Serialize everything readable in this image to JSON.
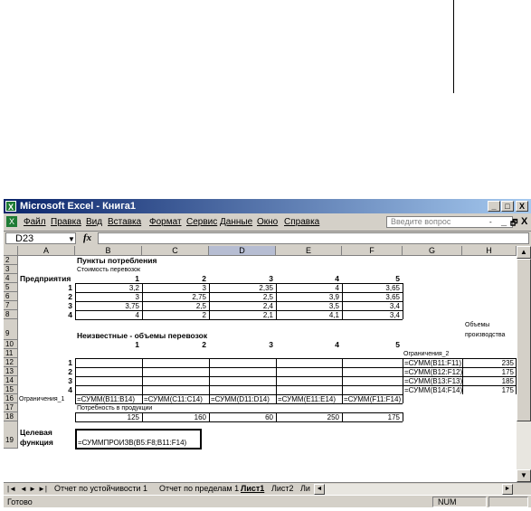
{
  "window": {
    "app_icon": "excel-icon",
    "title": "Microsoft Excel - Книга1",
    "controls": {
      "minimize": "_",
      "maximize": "□",
      "close": "X"
    }
  },
  "menu": {
    "items": [
      "Файл",
      "Правка",
      "Вид",
      "Вставка",
      "Формат",
      "Сервис",
      "Данные",
      "Окно",
      "Справка"
    ],
    "help_placeholder": "Введите вопрос",
    "doc_controls": [
      "-",
      "_",
      "🗗",
      "X"
    ]
  },
  "formula_bar": {
    "name_box": "D23",
    "fx": "fx",
    "content": ""
  },
  "columns": [
    "A",
    "B",
    "C",
    "D",
    "E",
    "F",
    "G",
    "H"
  ],
  "selected_column": "D",
  "rows": [
    "2",
    "3",
    "4",
    "5",
    "6",
    "7",
    "8",
    "9",
    "10",
    "11",
    "12",
    "13",
    "14",
    "15",
    "16",
    "17",
    "18",
    "19"
  ],
  "cells": {
    "B2": "Пункты потребления",
    "B3": "Стоимость перевозок",
    "A4": "Предприятия",
    "B4": "1",
    "C4": "2",
    "D4": "3",
    "E4": "4",
    "F4": "5",
    "A5": "1",
    "B5": "3,2",
    "C5": "3",
    "D5": "2,35",
    "E5": "4",
    "F5": "3,65",
    "A6": "2",
    "B6": "3",
    "C6": "2,75",
    "D6": "2,5",
    "E6": "3,9",
    "F6": "3,65",
    "A7": "3",
    "B7": "3,75",
    "C7": "2,5",
    "D7": "2,4",
    "E7": "3,5",
    "F7": "3,4",
    "A8": "4",
    "B8": "4",
    "C8": "2",
    "D8": "2,1",
    "E8": "4,1",
    "F8": "3,4",
    "B9": "Неизвестные - объемы перевозок",
    "H9a": "Объемы",
    "H9b": "производства",
    "B10": "1",
    "C10": "2",
    "D10": "3",
    "E10": "4",
    "F10": "5",
    "G10": "Ограничения_2",
    "A11": "1",
    "G11": "=СУММ(B11:F11)",
    "H11": "235",
    "A12": "2",
    "G12": "=СУММ(B12:F12)",
    "H12": "175",
    "A13": "3",
    "G13": "=СУММ(B13:F13)",
    "H13": "185",
    "A14": "4",
    "G14": "=СУММ(B14:F14)",
    "H14": "175",
    "A15": "Ограничения_1",
    "B15": "=СУММ(B11:B14)",
    "C15": "=СУММ(C11:C14)",
    "D15": "=СУММ(D11:D14)",
    "E15": "=СУММ(E11:E14)",
    "F15": "=СУММ(F11:F14)",
    "B16": "Потребность в продукции",
    "B17": "125",
    "C17": "160",
    "D17": "60",
    "E17": "250",
    "F17": "175",
    "A19a": "Целевая",
    "A19b": "функция",
    "B19": "=СУММПРОИЗВ(B5:F8;B11:F14)"
  },
  "sheet_tabs": [
    "Отчет по устойчивости 1",
    "Отчет по пределам 1",
    "Лист1",
    "Лист2",
    "Ли"
  ],
  "active_tab": "Лист1",
  "status": {
    "left": "Готово",
    "num": "NUM"
  },
  "colors": {
    "title_bar": "#0a246a",
    "chrome": "#d4d0c8",
    "selected_header": "#b6bdd2"
  }
}
